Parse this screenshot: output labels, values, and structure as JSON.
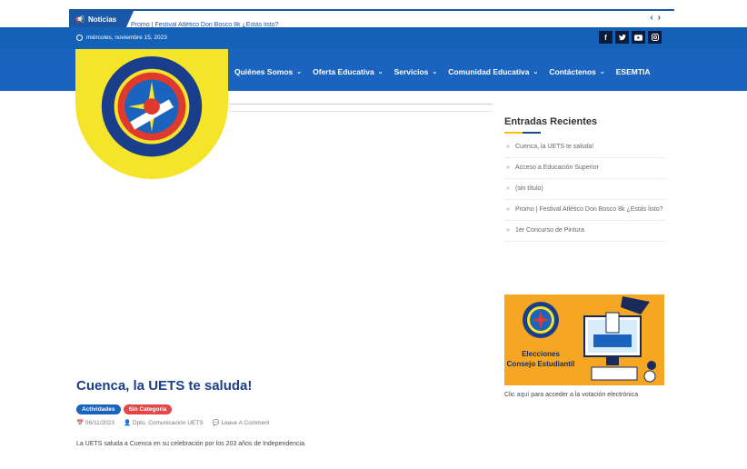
{
  "news": {
    "label": "Noticias",
    "ticker": "Promo | Festival Atlético Don Bosco 8k ¿Estás listo?",
    "arrows": "‹ ›"
  },
  "date_text": "miércoles, noviembre 15, 2023",
  "social": [
    "f",
    "t",
    "yt",
    "ig"
  ],
  "nav": [
    {
      "label": "Quiénes Somos",
      "dropdown": true
    },
    {
      "label": "Oferta Educativa",
      "dropdown": true
    },
    {
      "label": "Servicios",
      "dropdown": true
    },
    {
      "label": "Comunidad Educativa",
      "dropdown": true
    },
    {
      "label": "Contáctenos",
      "dropdown": true
    },
    {
      "label": "ESEMTIA",
      "dropdown": false
    }
  ],
  "logo": {
    "ring_text": "UNIDAD EDUCATIVA \"TÉCNICO SALESIANO\"",
    "motto": "ORACIÓN TRABAJO",
    "city": "CUENCA - ECUADOR"
  },
  "sidebar": {
    "title": "Entradas Recientes",
    "recent": [
      "Cuenca, la UETS te saluda!",
      "Acceso a Educación Superior",
      "(sin título)",
      "Promo | Festival Atlético Don Bosco 8k ¿Estás listo?",
      "1er Concurso de Pintura"
    ],
    "banner_text_1": "Elecciones",
    "banner_text_2": "Consejo Estudiantil",
    "caption_pre": "Clic ",
    "caption_link": "aquí",
    "caption_post": " para acceder a la votación electrónica"
  },
  "post": {
    "title": "Cuenca, la UETS te saluda!",
    "badges": [
      {
        "label": "Actividades",
        "color": "#1a63be"
      },
      {
        "label": "Sin Categoría",
        "color": "#e84545"
      }
    ],
    "date": "06/11/2023",
    "author": "Dpto. Comunicación UETS",
    "comment": "Leave A Comment",
    "excerpt": "La UETS saluda a Cuenca en su celebración por los 203 años de Independencia."
  },
  "colors": {
    "brand_blue": "#1a63be",
    "dark_blue": "#0d1b3a",
    "logo_yellow": "#f5e52a",
    "banner_orange": "#f5a623"
  }
}
